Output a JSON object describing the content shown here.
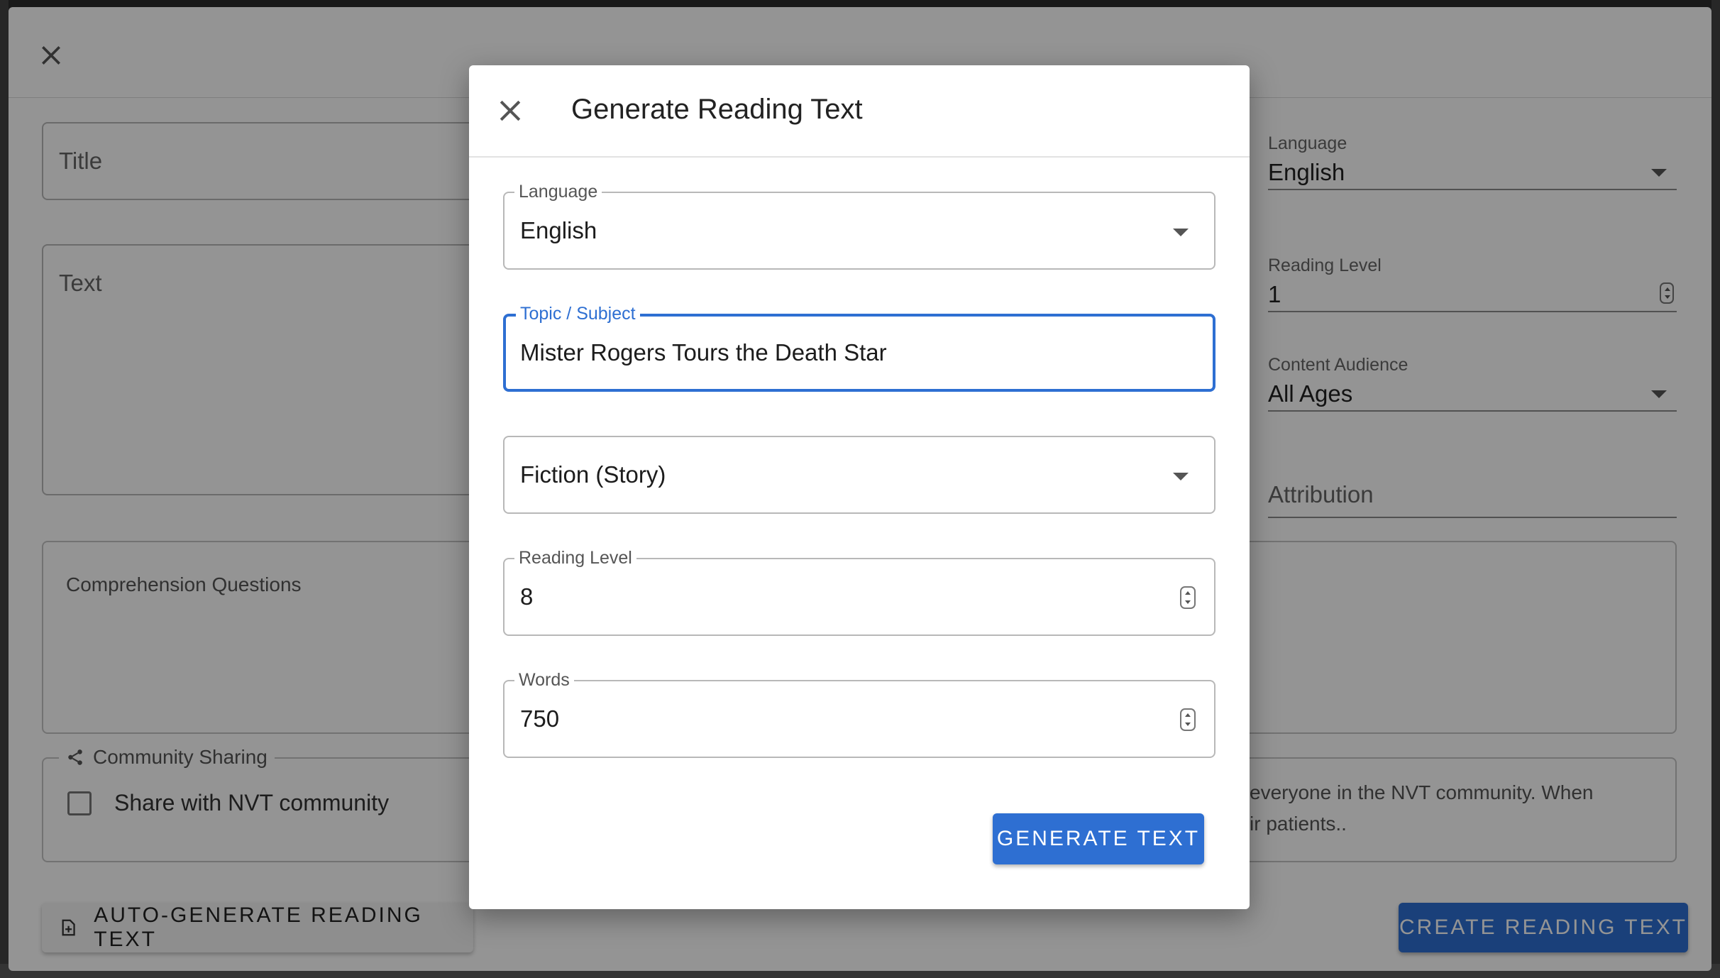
{
  "background": {
    "title_placeholder": "Title",
    "text_placeholder": "Text",
    "language": {
      "label": "Language",
      "value": "English"
    },
    "reading_level": {
      "label": "Reading Level",
      "value": "1"
    },
    "content_audience": {
      "label": "Content Audience",
      "value": "All Ages"
    },
    "attribution_placeholder": "Attribution",
    "comprehension_questions": "Comprehension Questions",
    "community_sharing": {
      "legend": "Community Sharing",
      "checkbox_label": "Share with NVT community",
      "description_line1": "everyone in the NVT community. When",
      "description_line2": "ir patients.."
    },
    "auto_generate_button": "AUTO-GENERATE READING TEXT",
    "create_button": "CREATE READING TEXT"
  },
  "modal": {
    "title": "Generate Reading Text",
    "language": {
      "label": "Language",
      "value": "English"
    },
    "topic": {
      "label": "Topic / Subject",
      "value": "Mister Rogers Tours the Death Star"
    },
    "genre": {
      "value": "Fiction (Story)"
    },
    "reading_level": {
      "label": "Reading Level",
      "value": "8"
    },
    "words": {
      "label": "Words",
      "value": "750"
    },
    "generate_button": "GENERATE TEXT"
  },
  "colors": {
    "primary": "#2e6fd2",
    "scrim": "rgba(0,0,0,0.42)"
  }
}
